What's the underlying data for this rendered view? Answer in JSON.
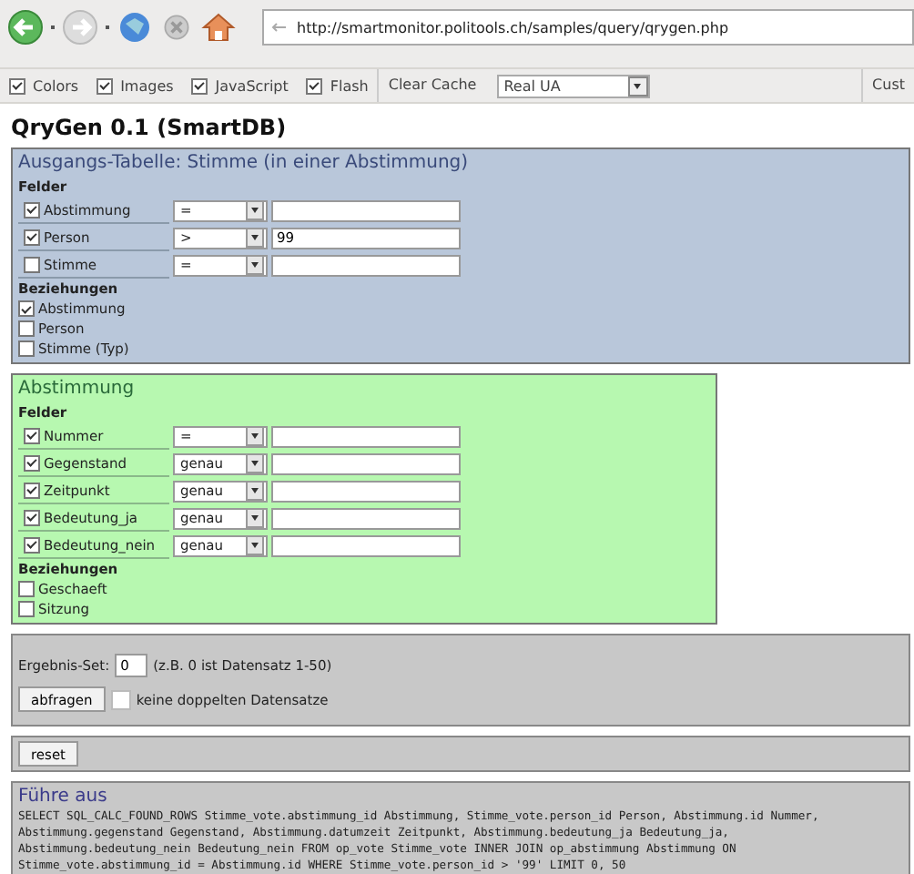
{
  "browser": {
    "url": "http://smartmonitor.politools.ch/samples/query/qrygen.php",
    "toolbar": [
      {
        "kind": "check",
        "label": "Colors",
        "checked": true
      },
      {
        "kind": "check",
        "label": "Images",
        "checked": true
      },
      {
        "kind": "check",
        "label": "JavaScript",
        "checked": true
      },
      {
        "kind": "check",
        "label": "Flash",
        "checked": true
      },
      {
        "kind": "button",
        "label": "Clear Cache"
      },
      {
        "kind": "select",
        "label": "Real UA"
      },
      {
        "kind": "button",
        "label": "Cust"
      }
    ]
  },
  "page_title": "QryGen 0.1 (SmartDB)",
  "tables": [
    {
      "kind": "source",
      "color": "#b9c7da",
      "title": "Ausgangs-Tabelle: Stimme (in einer Abstimmung)",
      "fields_heading": "Felder",
      "fields": [
        {
          "name": "Abstimmung",
          "checked": true,
          "operator": "="
        },
        {
          "name": "Person",
          "checked": true,
          "operator": ">",
          "value": "99"
        },
        {
          "name": "Stimme",
          "checked": false,
          "operator": "="
        }
      ],
      "relations_heading": "Beziehungen",
      "relations": [
        {
          "name": "Abstimmung",
          "checked": true
        },
        {
          "name": "Person",
          "checked": false
        },
        {
          "name": "Stimme (Typ)",
          "checked": false
        }
      ]
    },
    {
      "kind": "joined",
      "color": "#b7f8b0",
      "title": "Abstimmung",
      "fields_heading": "Felder",
      "fields": [
        {
          "name": "Nummer",
          "checked": true,
          "operator": "="
        },
        {
          "name": "Gegenstand",
          "checked": true,
          "operator": "genau"
        },
        {
          "name": "Zeitpunkt",
          "checked": true,
          "operator": "genau"
        },
        {
          "name": "Bedeutung_ja",
          "checked": true,
          "operator": "genau"
        },
        {
          "name": "Bedeutung_nein",
          "checked": true,
          "operator": "genau"
        }
      ],
      "relations_heading": "Beziehungen",
      "relations": [
        {
          "name": "Geschaeft",
          "checked": false
        },
        {
          "name": "Sitzung",
          "checked": false
        }
      ]
    }
  ],
  "result_set": {
    "label": "Ergebnis-Set:",
    "value": "0",
    "hint": "(z.B. 0 ist Datensatz 1-50)"
  },
  "query_button": "abfragen",
  "distinct": {
    "label": "keine doppelten Datensatze",
    "checked": false
  },
  "reset_button": "reset",
  "output": {
    "title": "Führe aus",
    "sql": "SELECT SQL_CALC_FOUND_ROWS Stimme_vote.abstimmung_id Abstimmung, Stimme_vote.person_id Person, Abstimmung.id Nummer, Abstimmung.gegenstand Gegenstand, Abstimmung.datumzeit Zeitpunkt, Abstimmung.bedeutung_ja Bedeutung_ja, Abstimmung.bedeutung_nein Bedeutung_nein FROM op_vote Stimme_vote INNER JOIN op_abstimmung Abstimmung ON Stimme_vote.abstimmung_id = Abstimmung.id WHERE Stimme_vote.person_id > '99' LIMIT 0, 50"
  }
}
